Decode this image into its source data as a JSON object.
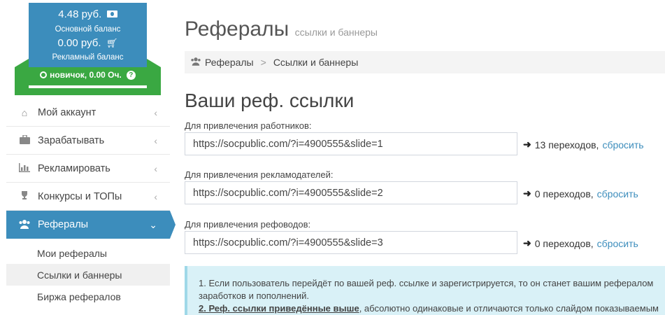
{
  "balance": {
    "main_amount": "4.48 руб.",
    "main_label": "Основной баланс",
    "ad_amount": "0.00 руб.",
    "ad_label": "Рекламный баланс",
    "rank": "новичок, 0.00 Оч."
  },
  "menu": [
    {
      "label": "Мой аккаунт",
      "icon": "home-icon"
    },
    {
      "label": "Зарабатывать",
      "icon": "briefcase-icon"
    },
    {
      "label": "Рекламировать",
      "icon": "bar-chart-icon"
    },
    {
      "label": "Конкурсы и ТОПы",
      "icon": "trophy-icon"
    },
    {
      "label": "Рефералы",
      "icon": "users-icon"
    }
  ],
  "submenu": [
    "Мои рефералы",
    "Ссылки и баннеры",
    "Биржа рефералов"
  ],
  "page": {
    "title": "Рефералы",
    "subtitle": "ссылки и баннеры",
    "breadcrumb": [
      "Рефералы",
      "Ссылки и баннеры"
    ],
    "section_title": "Ваши реф. ссылки"
  },
  "links": [
    {
      "label": "Для привлечения работников:",
      "url": "https://socpublic.com/?i=4900555&slide=1",
      "count": "13 переходов,",
      "reset": "сбросить"
    },
    {
      "label": "Для привлечения рекламодателей:",
      "url": "https://socpublic.com/?i=4900555&slide=2",
      "count": "0 переходов,",
      "reset": "сбросить"
    },
    {
      "label": "Для привлечения рефоводов:",
      "url": "https://socpublic.com/?i=4900555&slide=3",
      "count": "0 переходов,",
      "reset": "сбросить"
    }
  ],
  "info": {
    "line1": "1. Если пользователь перейдёт по вашей реф. ссылке и зарегистрируется, то он станет вашим рефералом",
    "line2": "заработков и пополнений.",
    "line3_bold": "2. Реф. ссылки приведённые выше",
    "line3_rest": ", абсолютно одинаковые и отличаются только слайдом показываемым"
  },
  "colors": {
    "primary": "#3c8dbc",
    "green": "#3aa842",
    "info_bg": "#d9f1f7"
  }
}
